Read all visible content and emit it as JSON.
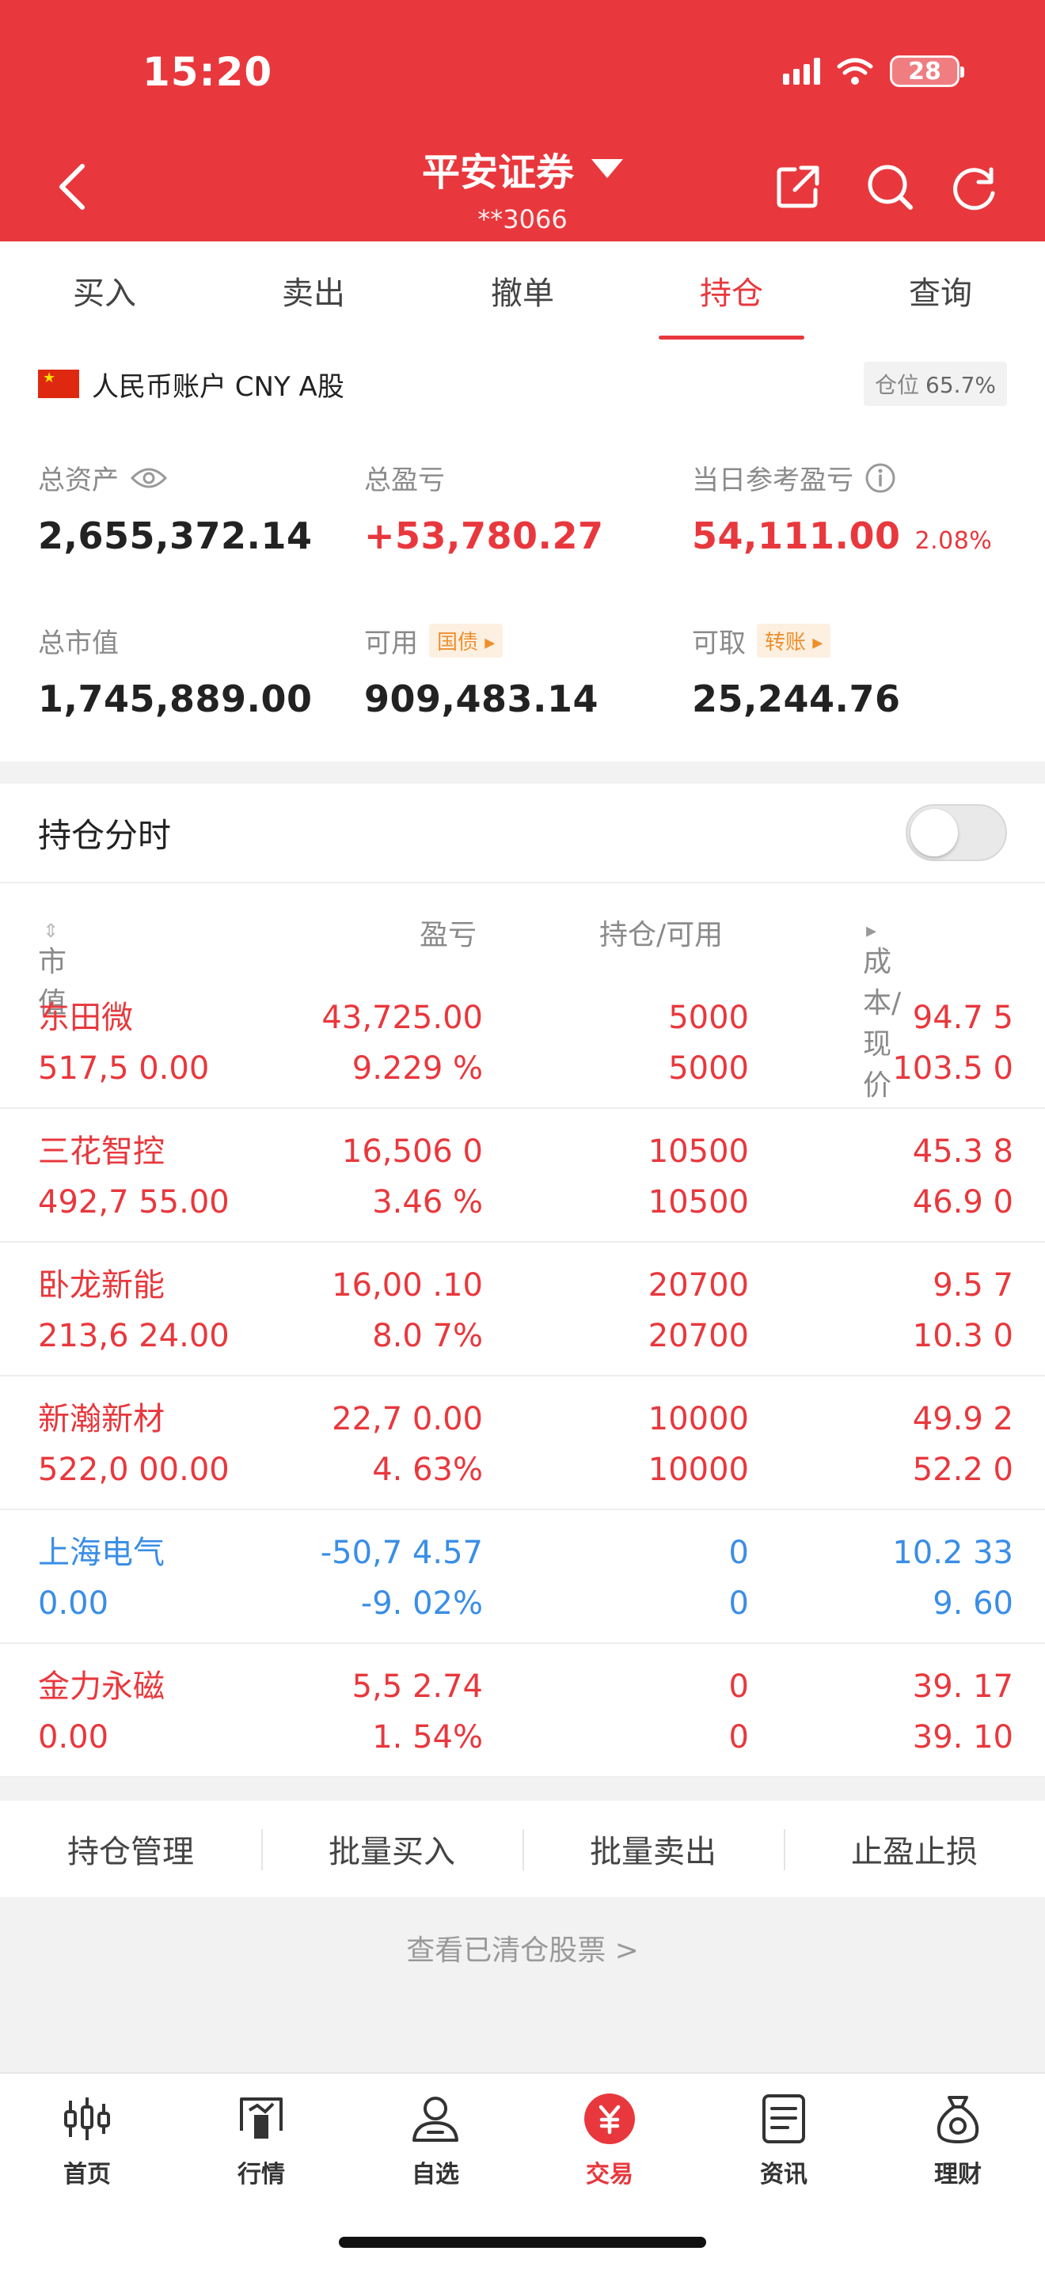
{
  "status_bar": {
    "time": "15:20",
    "battery": "28"
  },
  "header": {
    "broker": "平安证券",
    "account": "**3066"
  },
  "tabs": [
    {
      "label": "买入",
      "active": false
    },
    {
      "label": "卖出",
      "active": false
    },
    {
      "label": "撤单",
      "active": false
    },
    {
      "label": "持仓",
      "active": true
    },
    {
      "label": "查询",
      "active": false
    }
  ],
  "account": {
    "label": "人民币账户 CNY A股",
    "position_label": "仓位",
    "position_value": "65.7%"
  },
  "metrics": {
    "total_assets": {
      "label": "总资产",
      "value": "2,655,372.14"
    },
    "total_pnl": {
      "label": "总盈亏",
      "value": "+53,780.27"
    },
    "daily_pnl": {
      "label": "当日参考盈亏",
      "value": "54,111.00",
      "pct": "2.08%"
    },
    "market_value": {
      "label": "总市值",
      "value": "1,745,889.00"
    },
    "available": {
      "label": "可用",
      "tag": "国债",
      "value": "909,483.14"
    },
    "withdrawable": {
      "label": "可取",
      "tag": "转账",
      "value": "25,244.76"
    }
  },
  "holdings": {
    "title": "持仓分时",
    "columns": [
      "市值",
      "盈亏",
      "持仓/可用",
      "成本/现价"
    ],
    "rows": [
      {
        "name": "东田微",
        "market_value": "517,5  0.00",
        "pnl": "43,725.00",
        "pnl_pct": "9.229 %",
        "hold": "5000",
        "avail": "5000",
        "cost": "94.7 5",
        "price": "103.5 0",
        "trend": "up"
      },
      {
        "name": "三花智控",
        "market_value": "492,7 55.00",
        "pnl": "16,506  0",
        "pnl_pct": "3.46 %",
        "hold": "10500",
        "avail": "10500",
        "cost": "45.3 8",
        "price": "46.9 0",
        "trend": "up"
      },
      {
        "name": "卧龙新能",
        "market_value": "213,6 24.00",
        "pnl": "16,00 .10",
        "pnl_pct": "8.0 7%",
        "hold": "20700",
        "avail": "20700",
        "cost": "9.5 7",
        "price": "10.3 0",
        "trend": "up"
      },
      {
        "name": "新瀚新材",
        "market_value": "522,0 00.00",
        "pnl": "22,7  0.00",
        "pnl_pct": "4.  63%",
        "hold": "10000",
        "avail": "10000",
        "cost": "49.9 2",
        "price": "52.2 0",
        "trend": "up"
      },
      {
        "name": "上海电气",
        "market_value": "0.00",
        "pnl": "-50,7 4.57",
        "pnl_pct": "-9.  02%",
        "hold": "0",
        "avail": "0",
        "cost": "10.2 33",
        "price": "9. 60",
        "trend": "down"
      },
      {
        "name": "金力永磁",
        "market_value": "0.00",
        "pnl": "5,5 2.74",
        "pnl_pct": "1.  54%",
        "hold": "0",
        "avail": "0",
        "cost": "39. 17",
        "price": "39. 10",
        "trend": "up"
      }
    ]
  },
  "actions": [
    "持仓管理",
    "批量买入",
    "批量卖出",
    "止盈止损"
  ],
  "cleared_link": "查看已清仓股票 >",
  "bottom_nav": [
    {
      "label": "首页",
      "icon": "candlestick-icon",
      "active": false
    },
    {
      "label": "行情",
      "icon": "market-icon",
      "active": false
    },
    {
      "label": "自选",
      "icon": "person-icon",
      "active": false
    },
    {
      "label": "交易",
      "icon": "trade-yen-icon",
      "active": true
    },
    {
      "label": "资讯",
      "icon": "news-icon",
      "active": false
    },
    {
      "label": "理财",
      "icon": "money-bag-icon",
      "active": false
    }
  ],
  "colors": {
    "primary_red": "#e8383d",
    "down_blue": "#3a8ee6"
  }
}
